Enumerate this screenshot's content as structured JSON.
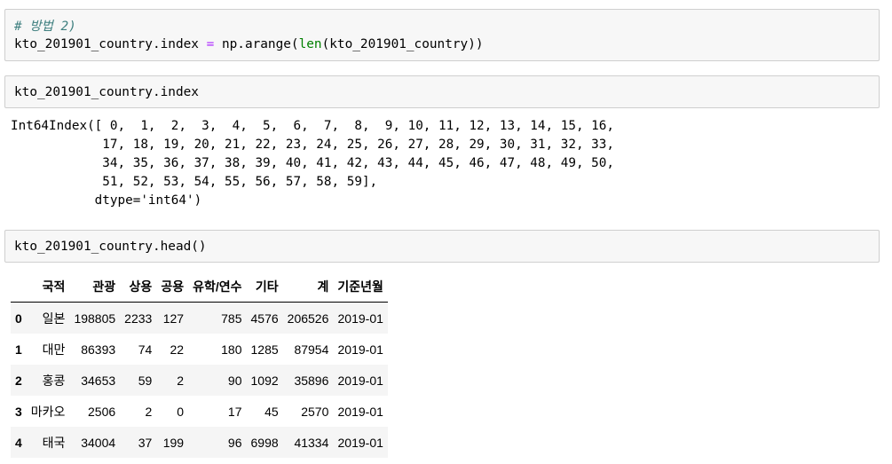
{
  "cell1": {
    "comment": "# 방법 2)",
    "var": "kto_201901_country.index",
    "op": "=",
    "call_before": "np.arange(",
    "builtin": "len",
    "call_after": "(kto_201901_country))"
  },
  "cell2": {
    "code": "kto_201901_country.index"
  },
  "output2": {
    "text": "Int64Index([ 0,  1,  2,  3,  4,  5,  6,  7,  8,  9, 10, 11, 12, 13, 14, 15, 16,\n            17, 18, 19, 20, 21, 22, 23, 24, 25, 26, 27, 28, 29, 30, 31, 32, 33,\n            34, 35, 36, 37, 38, 39, 40, 41, 42, 43, 44, 45, 46, 47, 48, 49, 50,\n            51, 52, 53, 54, 55, 56, 57, 58, 59],\n           dtype='int64')"
  },
  "cell3": {
    "code": "kto_201901_country.head()"
  },
  "table": {
    "columns": [
      "국적",
      "관광",
      "상용",
      "공용",
      "유학/연수",
      "기타",
      "계",
      "기준년월"
    ],
    "rows": [
      {
        "index": "0",
        "cells": [
          "일본",
          "198805",
          "2233",
          "127",
          "785",
          "4576",
          "206526",
          "2019-01"
        ]
      },
      {
        "index": "1",
        "cells": [
          "대만",
          "86393",
          "74",
          "22",
          "180",
          "1285",
          "87954",
          "2019-01"
        ]
      },
      {
        "index": "2",
        "cells": [
          "홍콩",
          "34653",
          "59",
          "2",
          "90",
          "1092",
          "35896",
          "2019-01"
        ]
      },
      {
        "index": "3",
        "cells": [
          "마카오",
          "2506",
          "2",
          "0",
          "17",
          "45",
          "2570",
          "2019-01"
        ]
      },
      {
        "index": "4",
        "cells": [
          "태국",
          "34004",
          "37",
          "199",
          "96",
          "6998",
          "41334",
          "2019-01"
        ]
      }
    ]
  }
}
